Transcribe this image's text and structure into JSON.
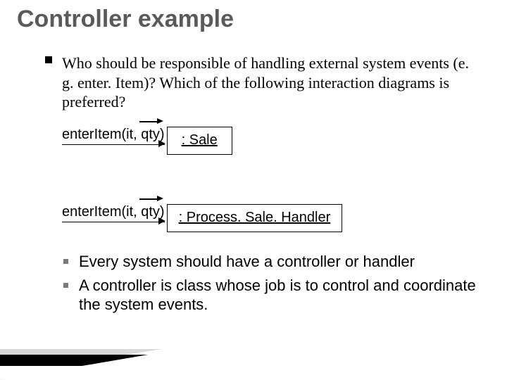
{
  "title": "Controller example",
  "intro": "Who should be responsible of handling external system events (e. g. enter. Item)? Which of the following interaction diagrams is preferred?",
  "diagrams": [
    {
      "message": "enterItem(it, qty)",
      "object": ": Sale"
    },
    {
      "message": "enterItem(it, qty)",
      "object": ": Process. Sale. Handler"
    }
  ],
  "sub_bullets": [
    "Every system should have a controller or handler",
    "A controller is class whose job is to control and coordinate the system events."
  ]
}
